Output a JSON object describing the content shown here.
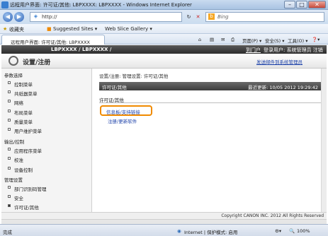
{
  "window": {
    "title": "远程用户界面: 许可证/其他: LBPXXXX: LBPXXXX - Windows Internet Explorer"
  },
  "address": {
    "url": "http://",
    "search_placeholder": "Bing"
  },
  "favorites": {
    "label": "收藏夹",
    "suggested": "Suggested Sites ▾",
    "slice": "Web Slice Gallery ▾"
  },
  "tab": {
    "label": "远程用户界面: 许可证/其他: LBPXXXX"
  },
  "commands": {
    "page": "页面(P) ▾",
    "safety": "安全(S) ▾",
    "tools": "工具(O) ▾",
    "help": "❓▾"
  },
  "header": {
    "model": "LBPXXXX / LBPXXXX /",
    "portal_link": "到门户",
    "user": "登录用户: 系统管理员 注销"
  },
  "settings": {
    "title": "设置/注册",
    "mail_link": "发送邮件到系统管理员"
  },
  "sidebar": {
    "sections": [
      {
        "label": "参数选择",
        "items": [
          {
            "label": "控制菜单",
            "active": false
          },
          {
            "label": "共纸器菜单",
            "active": false
          },
          {
            "label": "网络",
            "active": false
          },
          {
            "label": "布局菜单",
            "active": false
          },
          {
            "label": "质量菜单",
            "active": false
          },
          {
            "label": "用户维护菜单",
            "active": false
          }
        ]
      },
      {
        "label": "输出/控制",
        "items": [
          {
            "label": "应用程序菜单",
            "active": false
          },
          {
            "label": "校准",
            "active": false
          },
          {
            "label": "设备控制",
            "active": false
          }
        ]
      },
      {
        "label": "管理设置",
        "items": [
          {
            "label": "部门识别码管理",
            "active": false
          },
          {
            "label": "安全",
            "active": false
          },
          {
            "label": "许可证/其他",
            "active": true
          }
        ]
      }
    ]
  },
  "main": {
    "breadcrumb": "设置/注册: 管理设置: 许可证/其他",
    "bar_title": "许可证/其他",
    "last_update": "最近更新: 10/05 2012 19:29:42",
    "section_title": "许可证/其他",
    "link_info": "信息板/支持链接",
    "link_register": "注册/更新软件"
  },
  "footer": {
    "copyright": "Copyright CANON INC. 2012 All Rights Reserved"
  },
  "status": {
    "left": "完成",
    "zone": "Internet | 保护模式: 启用",
    "zoom": "100%"
  },
  "colors": {
    "highlight": "#f08a00",
    "link": "#1a3fa8",
    "header_bg": "#2c2c2c"
  }
}
